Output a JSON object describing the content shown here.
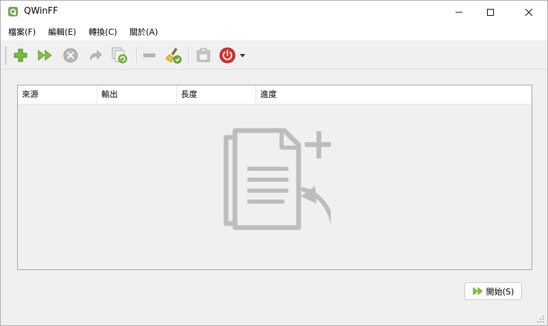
{
  "window": {
    "title": "QWinFF"
  },
  "menu": {
    "items": [
      "檔案(F)",
      "編輯(E)",
      "轉換(C)",
      "關於(A)"
    ]
  },
  "toolbar": {
    "buttons": [
      "add-icon",
      "start-icon",
      "stop-icon",
      "redo-icon",
      "refresh-icon",
      "remove-icon",
      "clear-icon",
      "paste-icon",
      "power-icon",
      "dropdown-arrow-icon"
    ]
  },
  "table": {
    "columns": [
      "來源",
      "輸出",
      "長度",
      "進度"
    ],
    "rows": []
  },
  "actions": {
    "start_label": "開始(S)"
  },
  "colors": {
    "accent_green": "#7ac143",
    "power_red": "#d9302e",
    "placeholder_gray": "#bdbdbd"
  }
}
